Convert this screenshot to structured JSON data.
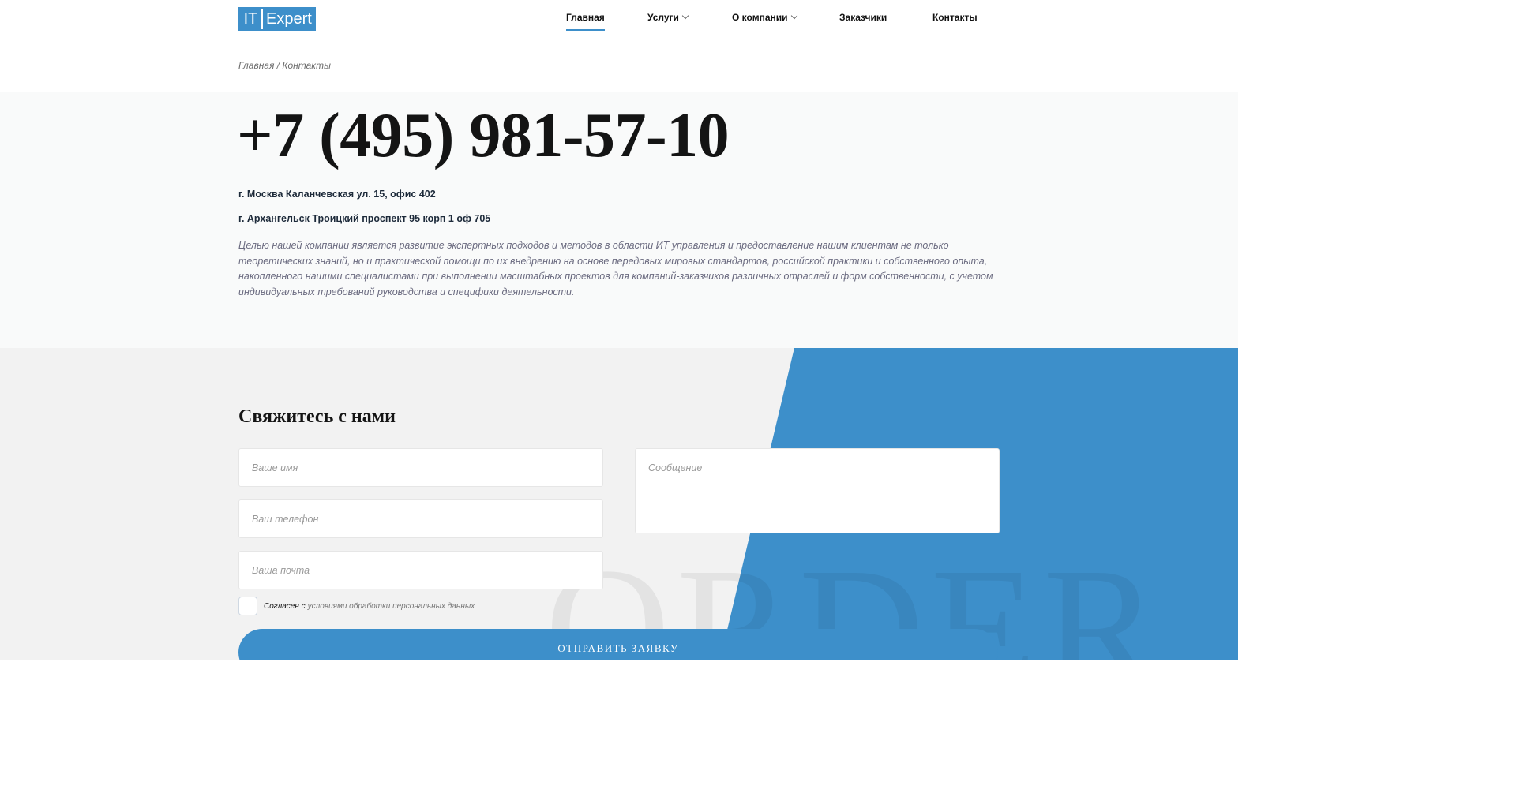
{
  "logo": {
    "part1": "IT",
    "part2": "Expert"
  },
  "nav": {
    "items": [
      {
        "label": "Главная",
        "has_dropdown": false,
        "active": true
      },
      {
        "label": "Услуги",
        "has_dropdown": true,
        "active": false
      },
      {
        "label": "О компании",
        "has_dropdown": true,
        "active": false
      },
      {
        "label": "Заказчики",
        "has_dropdown": false,
        "active": false
      },
      {
        "label": "Контакты",
        "has_dropdown": false,
        "active": false
      }
    ]
  },
  "breadcrumb": "Главная / Контакты",
  "contacts": {
    "phone": "+7 (495) 981-57-10",
    "address_moscow": "г. Москва Каланчевская ул. 15, офис 402",
    "address_arkhangelsk": "г. Архангельск Троицкий проспект 95 корп 1 оф 705",
    "about": "Целью нашей компании является развитие экспертных подходов и методов в области ИТ управления и предоставление нашим клиентам не только теоретических знаний, но и практической помощи по их внедрению на основе передовых мировых стандартов, российской практики и собственного опыта, накопленного нашими специалистами при выполнении масштабных проектов для компаний-заказчиков различных отраслей и форм собственности, с учетом индивидуальных требований руководства и специфики деятельности."
  },
  "form": {
    "title": "Свяжитесь с нами",
    "watermark": "ORDER",
    "name_placeholder": "Ваше имя",
    "phone_placeholder": "Ваш телефон",
    "email_placeholder": "Ваша почта",
    "message_placeholder": "Сообщение",
    "consent_text": "Согласен с",
    "consent_link": "условиями обработки персональных данных",
    "submit_label": "ОТПРАВИТЬ ЗАЯВКУ"
  },
  "colors": {
    "accent": "#3d8fca",
    "hero_bg": "#f9fafa",
    "form_bg": "#f2f2f2"
  }
}
